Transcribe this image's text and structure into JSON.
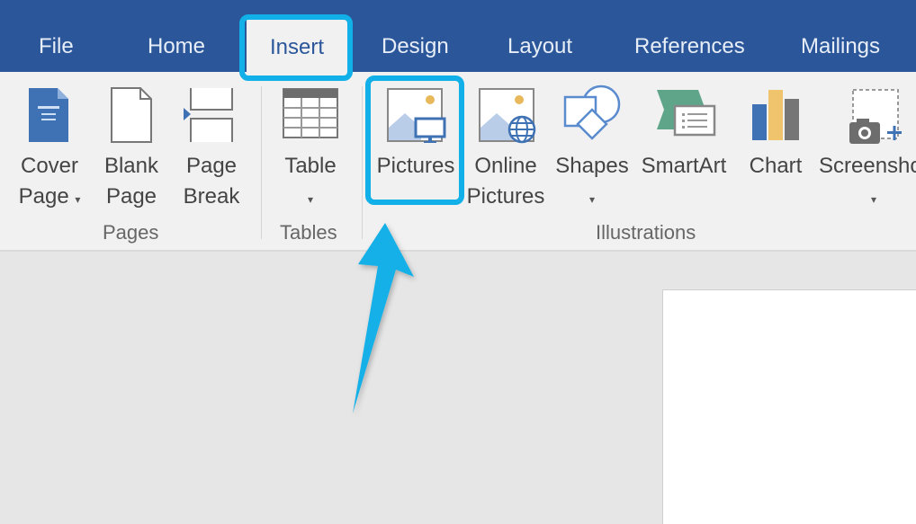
{
  "tabs": [
    {
      "label": "File"
    },
    {
      "label": "Home"
    },
    {
      "label": "Insert",
      "active": true
    },
    {
      "label": "Design"
    },
    {
      "label": "Layout"
    },
    {
      "label": "References"
    },
    {
      "label": "Mailings"
    }
  ],
  "ribbon": {
    "groups": {
      "pages": {
        "label": "Pages"
      },
      "tables": {
        "label": "Tables"
      },
      "illustrations": {
        "label": "Illustrations"
      }
    },
    "buttons": {
      "cover_page": {
        "line1": "Cover",
        "line2": "Page"
      },
      "blank_page": {
        "line1": "Blank",
        "line2": "Page"
      },
      "page_break": {
        "line1": "Page",
        "line2": "Break"
      },
      "table": {
        "line1": "Table"
      },
      "pictures": {
        "line1": "Pictures"
      },
      "online_pictures": {
        "line1": "Online",
        "line2": "Pictures"
      },
      "shapes": {
        "line1": "Shapes"
      },
      "smartart": {
        "line1": "SmartArt"
      },
      "chart": {
        "line1": "Chart"
      },
      "screenshot": {
        "line1": "Screenshot"
      }
    },
    "caret": "▾"
  },
  "annotation": {
    "color": "#12b0e8"
  }
}
